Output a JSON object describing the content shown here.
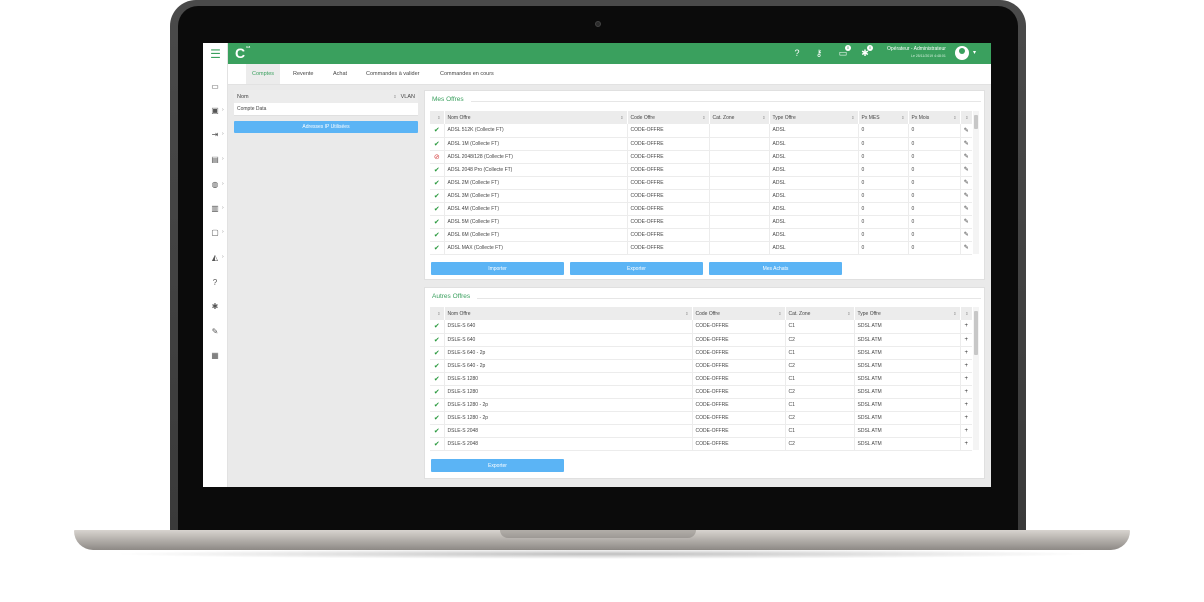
{
  "topbar": {
    "logo_letter": "C",
    "logo_small": "3.8",
    "user_name": "Opérateur - Administrateur",
    "user_date": "Le 25/11/2019 4:48:01",
    "badges": [
      "0",
      "0"
    ]
  },
  "tabs": [
    "Comptes",
    "Revente",
    "Achat",
    "Commandes à valider",
    "Commandes en cours"
  ],
  "left_panel": {
    "headers": [
      "Nom",
      "VLAN"
    ],
    "rows": [
      "Compte Data"
    ],
    "button": "Adresses IP Utilisées"
  },
  "mes_offres": {
    "title": "Mes Offres",
    "columns": [
      "Nom Offre",
      "Code Offre",
      "Cat. Zone",
      "Type Offre",
      "Px MES",
      "Px Mois"
    ],
    "rows": [
      {
        "status": "ok",
        "name": "ADSL 512K (Collecte FT)",
        "code": "CODE-OFFRE",
        "zone": "",
        "type": "ADSL",
        "mes": "0",
        "mois": "0"
      },
      {
        "status": "ok",
        "name": "ADSL 1M (Collecte FT)",
        "code": "CODE-OFFRE",
        "zone": "",
        "type": "ADSL",
        "mes": "0",
        "mois": "0"
      },
      {
        "status": "ko",
        "name": "ADSL 2048/128 (Collecte FT)",
        "code": "CODE-OFFRE",
        "zone": "",
        "type": "ADSL",
        "mes": "0",
        "mois": "0"
      },
      {
        "status": "ok",
        "name": "ADSL 2048 Pro (Collecte FT)",
        "code": "CODE-OFFRE",
        "zone": "",
        "type": "ADSL",
        "mes": "0",
        "mois": "0"
      },
      {
        "status": "ok",
        "name": "ADSL 2M (Collecte FT)",
        "code": "CODE-OFFRE",
        "zone": "",
        "type": "ADSL",
        "mes": "0",
        "mois": "0"
      },
      {
        "status": "ok",
        "name": "ADSL 3M (Collecte FT)",
        "code": "CODE-OFFRE",
        "zone": "",
        "type": "ADSL",
        "mes": "0",
        "mois": "0"
      },
      {
        "status": "ok",
        "name": "ADSL 4M (Collecte FT)",
        "code": "CODE-OFFRE",
        "zone": "",
        "type": "ADSL",
        "mes": "0",
        "mois": "0"
      },
      {
        "status": "ok",
        "name": "ADSL 5M (Collecte FT)",
        "code": "CODE-OFFRE",
        "zone": "",
        "type": "ADSL",
        "mes": "0",
        "mois": "0"
      },
      {
        "status": "ok",
        "name": "ADSL 6M (Collecte FT)",
        "code": "CODE-OFFRE",
        "zone": "",
        "type": "ADSL",
        "mes": "0",
        "mois": "0"
      },
      {
        "status": "ok",
        "name": "ADSL MAX (Collecte FT)",
        "code": "CODE-OFFRE",
        "zone": "",
        "type": "ADSL",
        "mes": "0",
        "mois": "0"
      }
    ],
    "buttons": [
      "Importer",
      "Exporter",
      "Mes Achats"
    ]
  },
  "autres_offres": {
    "title": "Autres Offres",
    "columns": [
      "Nom Offre",
      "Code Offre",
      "Cat. Zone",
      "Type Offre"
    ],
    "rows": [
      {
        "status": "ok",
        "name": "DSLE-S 640",
        "code": "CODE-OFFRE",
        "zone": "C1",
        "type": "SDSL ATM"
      },
      {
        "status": "ok",
        "name": "DSLE-S 640",
        "code": "CODE-OFFRE",
        "zone": "C2",
        "type": "SDSL ATM"
      },
      {
        "status": "ok",
        "name": "DSLE-S 640 - 2p",
        "code": "CODE-OFFRE",
        "zone": "C1",
        "type": "SDSL ATM"
      },
      {
        "status": "ok",
        "name": "DSLE-S 640 - 2p",
        "code": "CODE-OFFRE",
        "zone": "C2",
        "type": "SDSL ATM"
      },
      {
        "status": "ok",
        "name": "DSLE-S 1280",
        "code": "CODE-OFFRE",
        "zone": "C1",
        "type": "SDSL ATM"
      },
      {
        "status": "ok",
        "name": "DSLE-S 1280",
        "code": "CODE-OFFRE",
        "zone": "C2",
        "type": "SDSL ATM"
      },
      {
        "status": "ok",
        "name": "DSLE-S 1280 - 2p",
        "code": "CODE-OFFRE",
        "zone": "C1",
        "type": "SDSL ATM"
      },
      {
        "status": "ok",
        "name": "DSLE-S 1280 - 2p",
        "code": "CODE-OFFRE",
        "zone": "C2",
        "type": "SDSL ATM"
      },
      {
        "status": "ok",
        "name": "DSLE-S 2048",
        "code": "CODE-OFFRE",
        "zone": "C1",
        "type": "SDSL ATM"
      },
      {
        "status": "ok",
        "name": "DSLE-S 2048",
        "code": "CODE-OFFRE",
        "zone": "C2",
        "type": "SDSL ATM"
      }
    ],
    "buttons": [
      "Exporter"
    ]
  },
  "colors": {
    "brand": "#3aa05e",
    "button": "#5bb4f5",
    "ok": "#2b9a3f",
    "ko": "#d43c3c"
  }
}
